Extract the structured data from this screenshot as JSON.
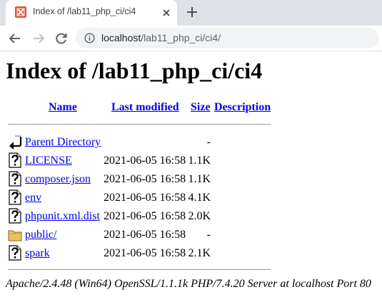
{
  "browser": {
    "tab_title": "Index of /lab11_php_ci/ci4",
    "url_host": "localhost",
    "url_path": "/lab11_php_ci/ci4/"
  },
  "page": {
    "heading": "Index of /lab11_php_ci/ci4",
    "columns": {
      "name": "Name",
      "last_modified": "Last modified",
      "size": "Size",
      "description": "Description"
    },
    "rows": [
      {
        "name": "Parent Directory",
        "date": "",
        "size": "-",
        "icon": "back-icon"
      },
      {
        "name": "LICENSE",
        "date": "2021-06-05 16:58",
        "size": "1.1K",
        "icon": "unknown-file-icon"
      },
      {
        "name": "composer.json",
        "date": "2021-06-05 16:58",
        "size": "1.1K",
        "icon": "unknown-file-icon"
      },
      {
        "name": "env",
        "date": "2021-06-05 16:58",
        "size": "4.1K",
        "icon": "unknown-file-icon"
      },
      {
        "name": "phpunit.xml.dist",
        "date": "2021-06-05 16:58",
        "size": "2.0K",
        "icon": "unknown-file-icon"
      },
      {
        "name": "public/",
        "date": "2021-06-05 16:58",
        "size": "-",
        "icon": "folder-icon"
      },
      {
        "name": "spark",
        "date": "2021-06-05 16:58",
        "size": "2.1K",
        "icon": "unknown-file-icon"
      }
    ],
    "footer": "Apache/2.4.48 (Win64) OpenSSL/1.1.1k PHP/7.4.20 Server at localhost Port 80"
  }
}
